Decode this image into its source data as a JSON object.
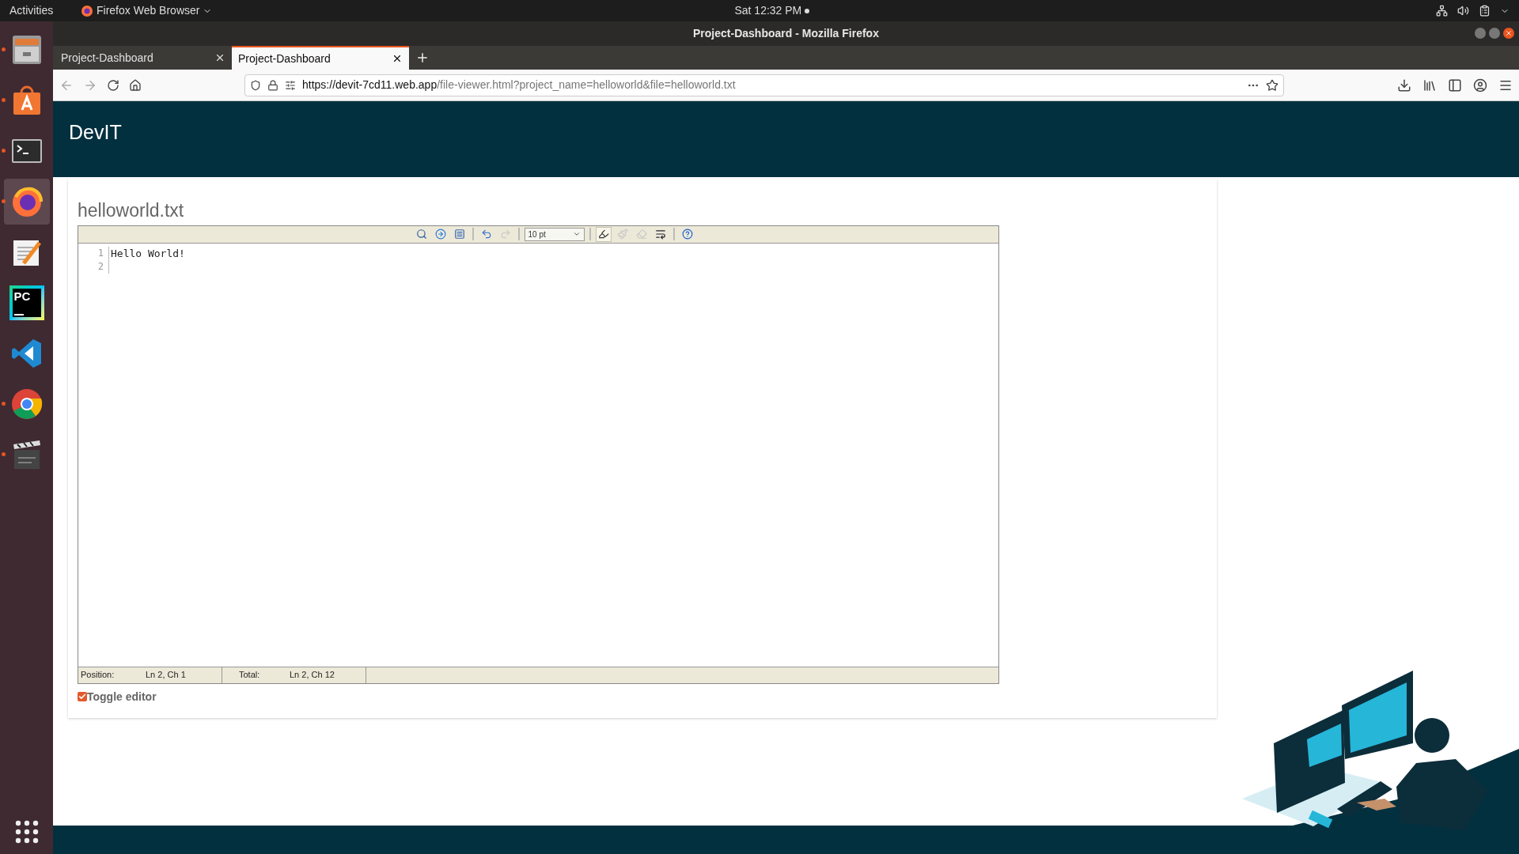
{
  "top_bar": {
    "activities": "Activities",
    "app_menu": "Firefox Web Browser",
    "clock": "Sat 12:32 PM"
  },
  "dock": [
    {
      "kind": "files",
      "running": true,
      "selected": false
    },
    {
      "kind": "store",
      "running": true,
      "selected": false
    },
    {
      "kind": "terminal",
      "running": true,
      "selected": false
    },
    {
      "kind": "firefox",
      "running": true,
      "selected": true
    },
    {
      "kind": "editor",
      "running": false,
      "selected": false
    },
    {
      "kind": "pycharm",
      "running": false,
      "selected": false,
      "icon_text": "PC"
    },
    {
      "kind": "vscode",
      "running": false,
      "selected": false
    },
    {
      "kind": "chrome",
      "running": true,
      "selected": false
    },
    {
      "kind": "video",
      "running": true,
      "selected": false
    }
  ],
  "window": {
    "title": "Project-Dashboard - Mozilla Firefox"
  },
  "tabs": [
    {
      "label": "Project-Dashboard",
      "selected": false
    },
    {
      "label": "Project-Dashboard",
      "selected": true
    }
  ],
  "address_bar": {
    "host": "https://devit-7cd11.web.app",
    "path": "/file-viewer.html?project_name=helloworld&file=helloworld.txt"
  },
  "page": {
    "brand": "DevIT",
    "file_title": "helloworld.txt",
    "toolbar": [
      {
        "kind": "search",
        "disabled": false
      },
      {
        "kind": "goto",
        "disabled": false
      },
      {
        "kind": "fullscreen",
        "disabled": false
      },
      {
        "kind": "sep"
      },
      {
        "kind": "undo",
        "disabled": false
      },
      {
        "kind": "redo",
        "disabled": true
      },
      {
        "kind": "sep"
      },
      {
        "kind": "font_size",
        "value": "10 pt"
      },
      {
        "kind": "sep"
      },
      {
        "kind": "highlight",
        "disabled": false,
        "pressed": true
      },
      {
        "kind": "brush",
        "disabled": true
      },
      {
        "kind": "eraser",
        "disabled": true
      },
      {
        "kind": "wrap",
        "disabled": false
      },
      {
        "kind": "sep"
      },
      {
        "kind": "help",
        "disabled": false
      }
    ],
    "lines": [
      {
        "number": "1",
        "text": "Hello World!"
      },
      {
        "number": "2"
      }
    ],
    "status": [
      {
        "label": "Position:",
        "value": "Ln 2, Ch 1"
      },
      {
        "label": "Total:",
        "value": "Ln 2, Ch 12"
      }
    ],
    "toggle": {
      "label": "Toggle editor",
      "checked": true
    }
  }
}
